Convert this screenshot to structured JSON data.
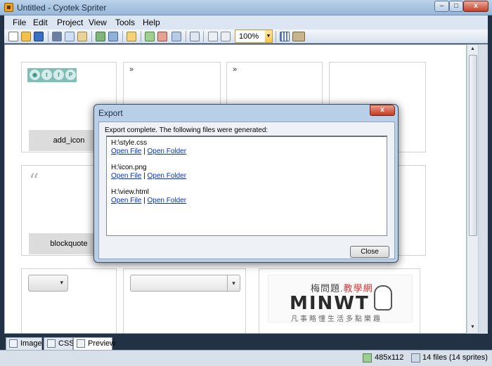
{
  "window": {
    "title": "Untitled - Cyotek Spriter"
  },
  "menu": {
    "items": [
      "File",
      "Edit",
      "Project",
      "View",
      "Tools",
      "Help"
    ]
  },
  "toolbar": {
    "zoom": "100%"
  },
  "canvas": {
    "cells": [
      {
        "label": "add_icon"
      },
      {
        "label": "blockquote"
      }
    ],
    "logo": {
      "cn_left": "梅問題.",
      "cn_right": "教學網",
      "main": "MINWT",
      "sub": "凡事略懂生活多點樂趣"
    }
  },
  "tabs": [
    "Image",
    "CSS",
    "Preview"
  ],
  "status": {
    "dimensions": "485x112",
    "files": "14 files (14 sprites)"
  },
  "dialog": {
    "title": "Export",
    "message": "Export complete. The following files were generated:",
    "files": [
      {
        "path": "H:\\style.css",
        "open_file": "Open File",
        "separator": "|",
        "open_folder": "Open Folder"
      },
      {
        "path": "H:\\icon.png",
        "open_file": "Open File",
        "separator": "|",
        "open_folder": "Open Folder"
      },
      {
        "path": "H:\\view.html",
        "open_file": "Open File",
        "separator": "|",
        "open_folder": "Open Folder"
      }
    ],
    "close_label": "Close"
  },
  "icons": {
    "close_glyph": "x",
    "quote_glyph": "“"
  }
}
